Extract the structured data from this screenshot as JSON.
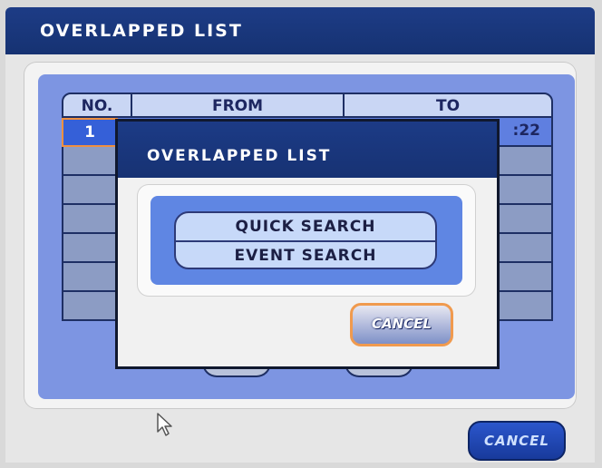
{
  "window": {
    "title": "OVERLAPPED LIST"
  },
  "table": {
    "headers": [
      "NO.",
      "FROM",
      "TO"
    ],
    "rows": [
      {
        "no": "1",
        "from": "",
        "to": ":22"
      }
    ]
  },
  "dialog": {
    "title": "OVERLAPPED LIST",
    "items": [
      "QUICK SEARCH",
      "EVENT SEARCH"
    ],
    "cancel_label": "CANCEL"
  },
  "footer": {
    "cancel_label": "CANCEL"
  },
  "colors": {
    "title_bar": "#1d3c86",
    "panel": "#7d95e2",
    "highlight": "#f09040"
  }
}
